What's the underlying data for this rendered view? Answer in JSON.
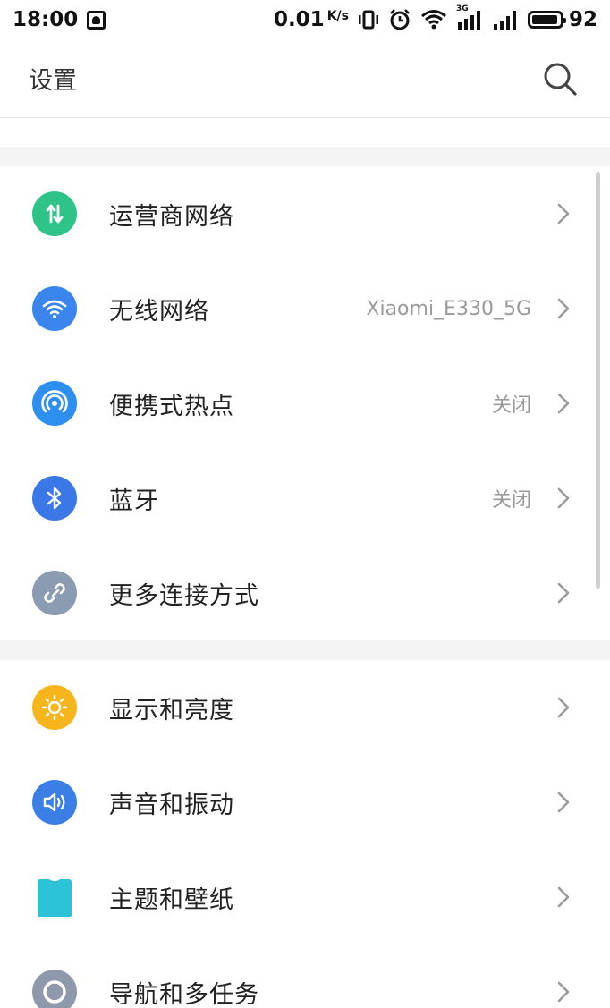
{
  "status_bar": {
    "time": "18:00",
    "net_speed": "0.01",
    "net_speed_unit": "K/s",
    "network_type": "3G",
    "battery_level": "92"
  },
  "header": {
    "title": "设置"
  },
  "groups": [
    {
      "items": [
        {
          "label": "运营商网络",
          "value": "",
          "icon": "carrier-network-icon",
          "color": "#2fc487"
        },
        {
          "label": "无线网络",
          "value": "Xiaomi_E330_5G",
          "icon": "wifi-icon",
          "color": "#3b86ee"
        },
        {
          "label": "便携式热点",
          "value": "关闭",
          "icon": "hotspot-icon",
          "color": "#2d8ff0"
        },
        {
          "label": "蓝牙",
          "value": "关闭",
          "icon": "bluetooth-icon",
          "color": "#3b78e7"
        },
        {
          "label": "更多连接方式",
          "value": "",
          "icon": "link-icon",
          "color": "#8b9bb1"
        }
      ]
    },
    {
      "items": [
        {
          "label": "显示和亮度",
          "value": "",
          "icon": "brightness-icon",
          "color": "#f6b51a"
        },
        {
          "label": "声音和振动",
          "value": "",
          "icon": "sound-icon",
          "color": "#3b7fe6"
        },
        {
          "label": "主题和壁纸",
          "value": "",
          "icon": "theme-icon",
          "color": "#2cc3d8"
        },
        {
          "label": "导航和多任务",
          "value": "",
          "icon": "navigation-icon",
          "color": "#8e9aab"
        }
      ]
    }
  ]
}
